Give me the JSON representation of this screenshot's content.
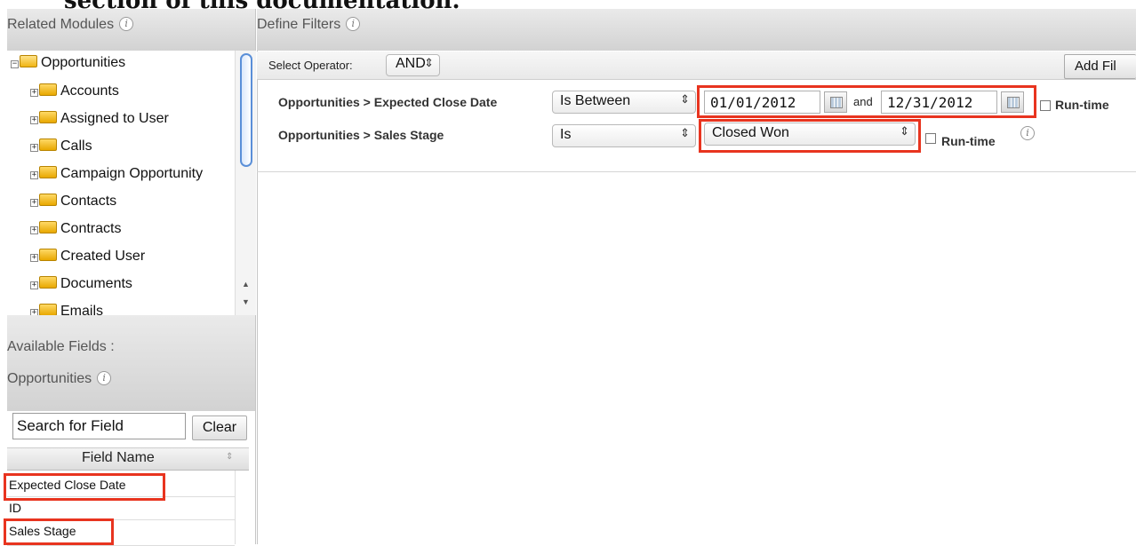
{
  "doc_heading": "section of this documentation.",
  "related_modules": {
    "title": "Related Modules",
    "root": "Opportunities",
    "items": [
      "Accounts",
      "Assigned to User",
      "Calls",
      "Campaign Opportunity",
      "Contacts",
      "Contracts",
      "Created User",
      "Documents",
      "Emails"
    ]
  },
  "available_fields": {
    "title_line1": "Available Fields :",
    "title_line2": "Opportunities",
    "search_value": "Search for Field",
    "clear_label": "Clear",
    "column_header": "Field Name",
    "rows": [
      "Expected Close Date",
      "ID",
      "Sales Stage"
    ]
  },
  "define_filters": {
    "title": "Define Filters",
    "operator_label": "Select Operator:",
    "operator_value": "AND",
    "add_filter_label": "Add Fil",
    "filters": [
      {
        "field": "Opportunities > Expected Close Date",
        "qualifier": "Is Between",
        "from": "01/01/2012",
        "and_label": "and",
        "to": "12/31/2012",
        "runtime_label": "Run-time"
      },
      {
        "field": "Opportunities > Sales Stage",
        "qualifier": "Is",
        "value": "Closed Won",
        "runtime_label": "Run-time"
      }
    ]
  },
  "colors": {
    "highlight": "#e8341f",
    "header_bg": "#dcdcdc",
    "folder": "#f0b514"
  }
}
